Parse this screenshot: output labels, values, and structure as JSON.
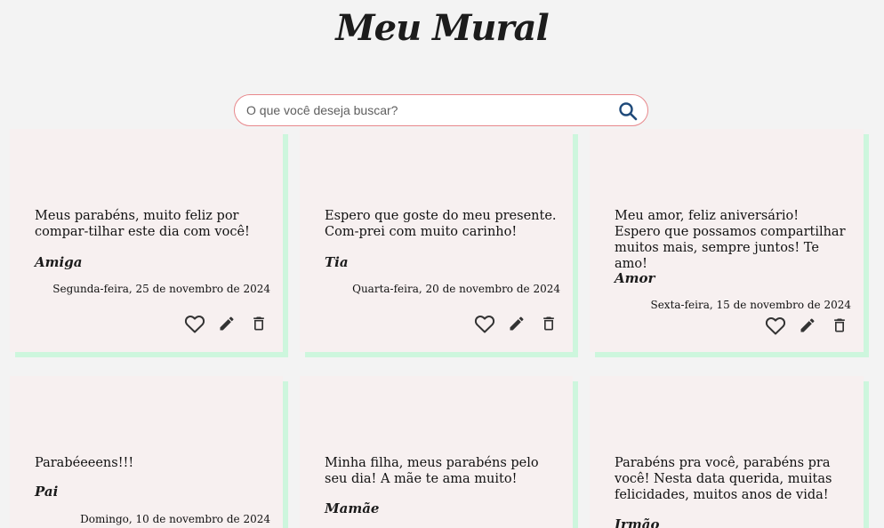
{
  "header": {
    "title": "Meu Mural"
  },
  "search": {
    "placeholder": "O que você deseja buscar?",
    "icon": "search-icon"
  },
  "colors": {
    "background": "#f3f3f3",
    "card": "#f7f0f0",
    "card_shadow": "#cdf6dd",
    "search_border": "#e8888c",
    "search_icon": "#1f4a7a"
  },
  "cards": [
    {
      "message": "Meus parabéns, muito feliz por compar-tilhar este dia com você!",
      "author": "Amiga",
      "date": "Segunda-feira, 25 de novembro de 2024"
    },
    {
      "message": "Espero que goste do meu presente. Com-prei com muito carinho!",
      "author": "Tia",
      "date": "Quarta-feira, 20 de novembro de 2024"
    },
    {
      "message": "Meu amor, feliz aniversário! Espero que possamos compartilhar muitos mais, sempre juntos! Te amo!",
      "author": "Amor",
      "date": "Sexta-feira, 15 de novembro de 2024"
    },
    {
      "message": "Parabéeeens!!!",
      "author": "Pai",
      "date": "Domingo, 10 de novembro de 2024"
    },
    {
      "message": "Minha filha, meus parabéns pelo seu dia! A mãe te ama muito!",
      "author": "Mamãe",
      "date": ""
    },
    {
      "message": "Parabéns pra você, parabéns pra você! Nesta data querida, muitas felicidades, muitos anos de vida!",
      "author": "Irmão",
      "date": ""
    }
  ]
}
